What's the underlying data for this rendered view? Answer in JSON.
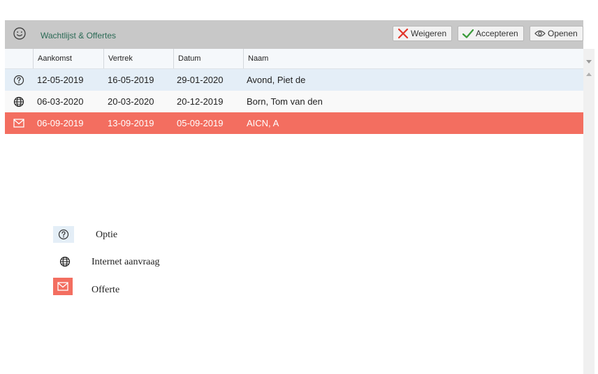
{
  "panel": {
    "title": "Wachtlijst & Offertes",
    "icon": "smiley-icon",
    "buttons": {
      "weigeren": "Weigeren",
      "accepteren": "Accepteren",
      "openen": "Openen"
    }
  },
  "table": {
    "columns": [
      "Aankomst",
      "Vertrek",
      "Datum",
      "Naam"
    ],
    "rows": [
      {
        "icon": "question-icon",
        "aankomst": "12-05-2019",
        "vertrek": "16-05-2019",
        "datum": "29-01-2020",
        "naam": "Avond, Piet de"
      },
      {
        "icon": "globe-icon",
        "aankomst": "06-03-2020",
        "vertrek": "20-03-2020",
        "datum": "20-12-2019",
        "naam": "Born, Tom van den"
      },
      {
        "icon": "envelope-icon",
        "aankomst": "06-09-2019",
        "vertrek": "13-09-2019",
        "datum": "05-09-2019",
        "naam": "AICN, A"
      }
    ]
  },
  "legend": [
    {
      "icon": "question-icon",
      "label": "Optie"
    },
    {
      "icon": "globe-icon",
      "label": "Internet aanvraag"
    },
    {
      "icon": "envelope-icon",
      "label": "Offerte"
    }
  ],
  "colors": {
    "optie": "#e4eef7",
    "internet": "#f9f9f9",
    "offerte": "#f36e60",
    "header": "#c8c8c8",
    "title": "#2a6a55"
  }
}
